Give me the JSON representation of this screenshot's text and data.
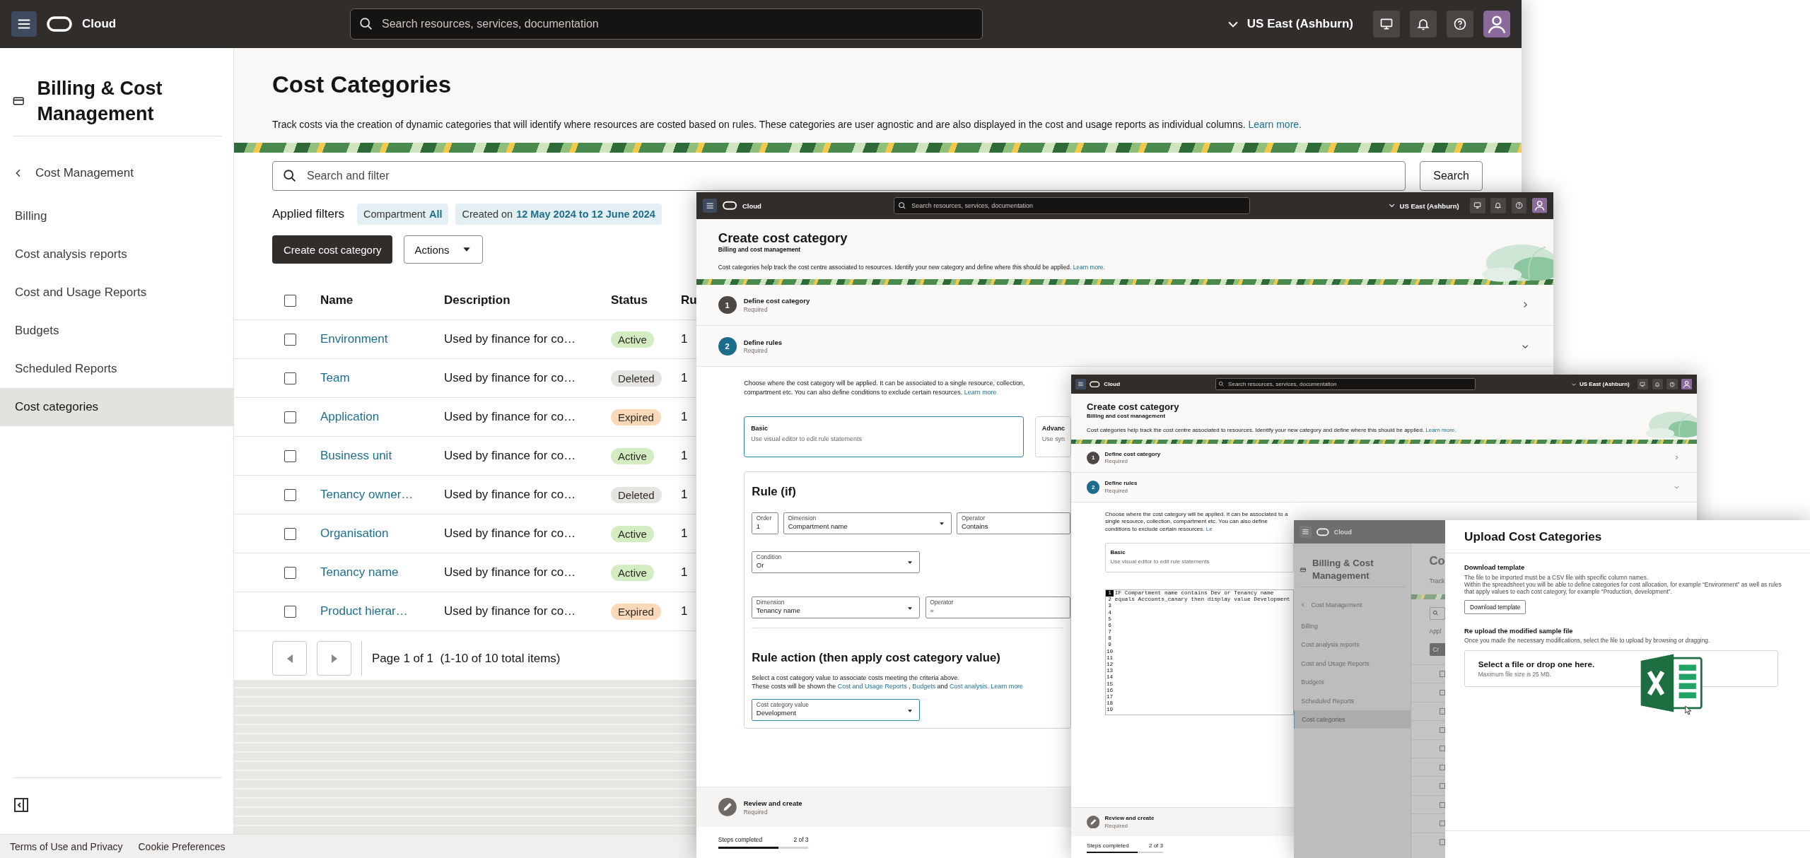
{
  "main_window": {
    "top_bar": {
      "brand": "Cloud",
      "search": {
        "placeholder": "Search resources, services, documentation"
      },
      "region": "US East (Ashburn)"
    },
    "sidebar": {
      "title": "Billing & Cost Management",
      "back_link": "Cost Management",
      "items": [
        {
          "label": "Billing",
          "selected": false
        },
        {
          "label": "Cost analysis reports",
          "selected": false
        },
        {
          "label": "Cost and Usage Reports",
          "selected": false
        },
        {
          "label": "Budgets",
          "selected": false
        },
        {
          "label": "Scheduled Reports",
          "selected": false
        },
        {
          "label": "Cost categories",
          "selected": true
        }
      ]
    },
    "page": {
      "title": "Cost Categories",
      "description": "Track costs via the creation of dynamic categories that will identify where resources are costed based on rules. These categories are user agnostic and are also displayed in the cost and usage reports as individual columns.",
      "learn_more": "Learn more.",
      "search": {
        "placeholder": "Search and filter",
        "button": "Search"
      },
      "applied_filters": {
        "label": "Applied filters",
        "filters": [
          {
            "name": "Compartment",
            "value": "All"
          },
          {
            "name": "Created on",
            "value": "12 May 2024 to 12 June 2024"
          }
        ]
      },
      "create_button": "Create cost category",
      "actions_menu": "Actions",
      "table": {
        "select_all": {
          "checked": false
        },
        "columns": [
          "Name",
          "Description",
          "Status",
          "Ru"
        ],
        "rows": [
          {
            "checked": false,
            "name": "Environment",
            "description": "Used by finance for co…",
            "status": "Active",
            "color": "#d3ecc1",
            "column_4": "1"
          },
          {
            "checked": false,
            "name": "Team",
            "description": "Used by finance for co…",
            "status": "Deleted",
            "color": "#e6e4e1",
            "column_4": "1"
          },
          {
            "checked": false,
            "name": "Application",
            "description": "Used by finance for co…",
            "status": "Expired",
            "color": "#fad9b8",
            "column_4": "1"
          },
          {
            "checked": false,
            "name": "Business unit",
            "description": "Used by finance for co…",
            "status": "Active",
            "color": "#d3ecc1",
            "column_4": "1"
          },
          {
            "checked": false,
            "name": "Tenancy owner…",
            "description": "Used by finance for co…",
            "status": "Deleted",
            "color": "#e6e4e1",
            "column_4": "1"
          },
          {
            "checked": false,
            "name": "Organisation",
            "description": "Used by finance for co…",
            "status": "Active",
            "color": "#d3ecc1",
            "column_4": "1"
          },
          {
            "checked": false,
            "name": "Tenancy name",
            "description": "Used by finance for co…",
            "status": "Active",
            "color": "#d3ecc1",
            "column_4": "1"
          },
          {
            "checked": false,
            "name": "Product hierar…",
            "description": "Used by finance for co…",
            "status": "Expired",
            "color": "#fad9b8",
            "column_4": "1"
          }
        ]
      },
      "pagination": "Page 1 of 1  (1-10 of 10 total items)"
    },
    "footer": {
      "links": [
        "Terms of Use and Privacy",
        "Cookie Preferences"
      ]
    }
  },
  "create_window": {
    "top_bar": {
      "brand": "Cloud",
      "search": {
        "placeholder": "Search resources, services, documentation"
      },
      "region": "US East (Ashburn)"
    },
    "title": "Create cost category",
    "subtitle": "Billing and cost management",
    "description": "Cost categories help track the cost centre associated to resources. Identify your new category and define where this should be applied.",
    "learn_more": "Learn more.",
    "steps": [
      {
        "number": "1",
        "title": "Define cost category",
        "note": "Required",
        "current": false,
        "expanded": false
      },
      {
        "number": "2",
        "title": "Define rules",
        "note": "Required",
        "current": true,
        "expanded": true
      }
    ],
    "intro": {
      "text": "Choose where the cost category will be applied. It can be associated to a single resource, collection, compartment etc. You can also define conditions to exclude certain resources.",
      "link": "Learn more"
    },
    "modes": [
      {
        "title": "Basic",
        "hint": "Use visual editor to edit rule statements",
        "selected": true
      },
      {
        "title": "Advanc",
        "hint": "Use syn",
        "selected": false
      }
    ],
    "rule": {
      "heading": "Rule (if)",
      "rows": [
        [
          {
            "kind": "number",
            "label": "Order",
            "value": "1"
          },
          {
            "kind": "select",
            "label": "Dimension",
            "value": "Compartment name"
          },
          {
            "kind": "text",
            "label": "Operator",
            "value": "Contains"
          }
        ],
        [
          {
            "kind": "select",
            "label": "Condition",
            "value": "Or"
          }
        ],
        [
          {
            "kind": "select",
            "label": "Dimension",
            "value": "Tenancy name"
          },
          {
            "kind": "text",
            "label": "Operator",
            "value": "="
          }
        ]
      ],
      "action_heading": "Rule action (then apply cost category value)",
      "action_text": "Select a cost category value to associate costs meeting the criteria above.",
      "action_links": [
        {
          "text": "These costs will be shown the",
          "kind": "text"
        },
        {
          "text": "Cost and Usage Reports",
          "kind": "link"
        },
        {
          "text": ",",
          "kind": "text"
        },
        {
          "text": "Budgets",
          "kind": "link"
        },
        {
          "text": "and",
          "kind": "text"
        },
        {
          "text": "Cost analysis.",
          "kind": "link"
        },
        {
          "text": "Learn more",
          "kind": "link"
        }
      ],
      "value_field": {
        "kind": "select",
        "label": "Cost category value",
        "value": "Development",
        "focused": true
      }
    },
    "review": {
      "title": "Review and create",
      "note": "Required"
    },
    "progress": {
      "label": "Steps completed",
      "count": "2 of 3",
      "level": 0.67
    }
  },
  "create_window_small": {
    "top_bar": {
      "brand": "Cloud",
      "search": {
        "placeholder": "Search resources, services, documentation"
      },
      "region": "US East (Ashburn)"
    },
    "title": "Create cost category",
    "subtitle": "Billing and cost management",
    "description": "Cost categories help track the cost centre associated to resources. Identify your new category and define where this should be applied.",
    "learn_more": "Learn more.",
    "steps": [
      {
        "number": "1",
        "title": "Define cost category",
        "note": "Required",
        "current": false,
        "expanded": false
      },
      {
        "number": "2",
        "title": "Define rules",
        "note": "Required",
        "current": true,
        "expanded": true
      }
    ],
    "intro": {
      "text": "Choose where the cost category will be applied. It can be associated to a single resource, collection, compartment etc. You can also define conditions to exclude certain resources.",
      "link": "Le"
    },
    "modes": [
      {
        "title": "Basic",
        "hint": "Use visual editor to edit rule statements",
        "selected": false
      }
    ],
    "editor": {
      "line_numbers": [
        {
          "number": "1",
          "current": true
        },
        {
          "number": "2",
          "current": false
        },
        {
          "number": "3",
          "current": false
        },
        {
          "number": "4",
          "current": false
        },
        {
          "number": "5",
          "current": false
        },
        {
          "number": "6",
          "current": false
        },
        {
          "number": "7",
          "current": false
        },
        {
          "number": "8",
          "current": false
        },
        {
          "number": "9",
          "current": false
        },
        {
          "number": "10",
          "current": false
        },
        {
          "number": "11",
          "current": false
        },
        {
          "number": "12",
          "current": false
        },
        {
          "number": "13",
          "current": false
        },
        {
          "number": "14",
          "current": false
        },
        {
          "number": "15",
          "current": false
        },
        {
          "number": "16",
          "current": false
        },
        {
          "number": "17",
          "current": false
        },
        {
          "number": "18",
          "current": false
        },
        {
          "number": "19",
          "current": false
        }
      ],
      "lines": [
        "IF Compartment name contains Dev or Tenancy name",
        "equals Accounts_canary then display value Development"
      ]
    },
    "review": {
      "title": "Review and create",
      "note": "Required"
    },
    "progress": {
      "label": "Steps completed",
      "count": "2 of 3",
      "level": 0.67
    }
  },
  "upload_window": {
    "top_bar": {
      "brand": "Cloud"
    },
    "sidebar": {
      "title": "Billing & Cost Management",
      "back_link": "Cost Management",
      "items": [
        {
          "label": "Billing",
          "selected": false
        },
        {
          "label": "Cost analysis reports",
          "selected": false
        },
        {
          "label": "Cost and Usage Reports",
          "selected": false
        },
        {
          "label": "Budgets",
          "selected": false
        },
        {
          "label": "Scheduled Reports",
          "selected": false
        },
        {
          "label": "Cost categories",
          "selected": true
        }
      ]
    },
    "page": {
      "title": "Co",
      "description": "Track",
      "filters_label": "Appl",
      "button": "Cr",
      "rows": [
        {
          "checked": false
        },
        {
          "checked": false
        },
        {
          "checked": false
        },
        {
          "checked": false
        },
        {
          "checked": false
        },
        {
          "checked": false
        },
        {
          "checked": false
        },
        {
          "checked": false
        },
        {
          "checked": false
        },
        {
          "checked": false
        }
      ]
    },
    "panel": {
      "title": "Upload Cost Categories",
      "download": {
        "heading": "Download template",
        "text": [
          "The file to be imported must be a CSV file with specific column names.",
          "Within the spreadsheet you will be able to define categories for cost allocation, for example “Environment” as well as rules that apply values to each cost category, for example “Production, development”."
        ],
        "button": "Download template"
      },
      "upload": {
        "heading": "Re upload the modified sample file",
        "text": "Once you made the necessary modifications, select the file to upload by browsing or dragging.",
        "drop_title": "Select a file or drop one here.",
        "drop_hint": "Maximum file size is 25 MB."
      }
    }
  }
}
